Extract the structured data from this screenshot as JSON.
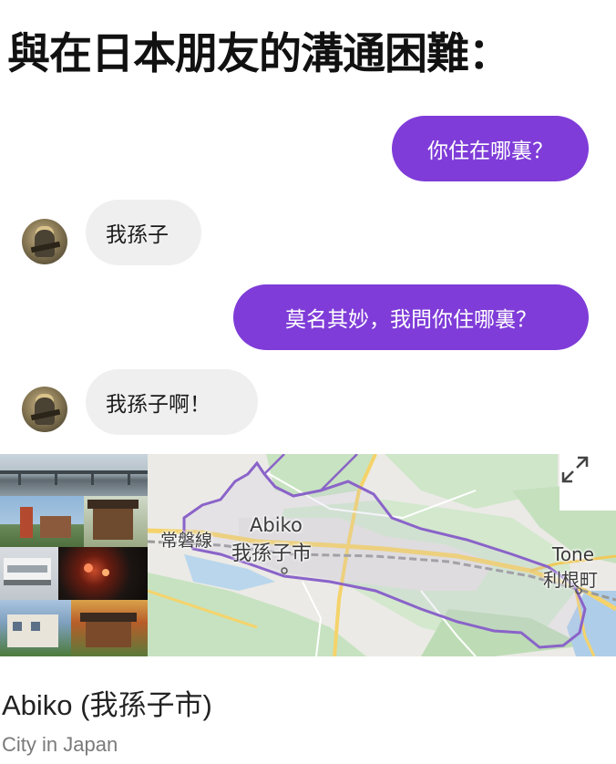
{
  "title": "與在日本朋友的溝通困難：",
  "messages": [
    {
      "side": "out",
      "text": "你住在哪裏？"
    },
    {
      "side": "in",
      "text": "我孫子"
    },
    {
      "side": "out",
      "text": "莫名其妙，我問你住哪裏？"
    },
    {
      "side": "in",
      "text": "我孫子啊！"
    }
  ],
  "map_card": {
    "labels": {
      "line_name": "常磐線",
      "city_en": "Abiko",
      "city_jp": "我孫子市",
      "tone_en": "Tone",
      "tone_jp": "利根町"
    },
    "expand_icon": "expand-arrows-icon"
  },
  "place": {
    "name": "Abiko (我孫子市)",
    "subtitle": "City in Japan"
  },
  "colors": {
    "outgoing_bubble": "#7f3cd8",
    "incoming_bubble": "#efefef",
    "map_background": "#ebeae6",
    "map_green": "#bfe0b9",
    "boundary": "#8a63c9",
    "road_yellow": "#f5d36a"
  }
}
